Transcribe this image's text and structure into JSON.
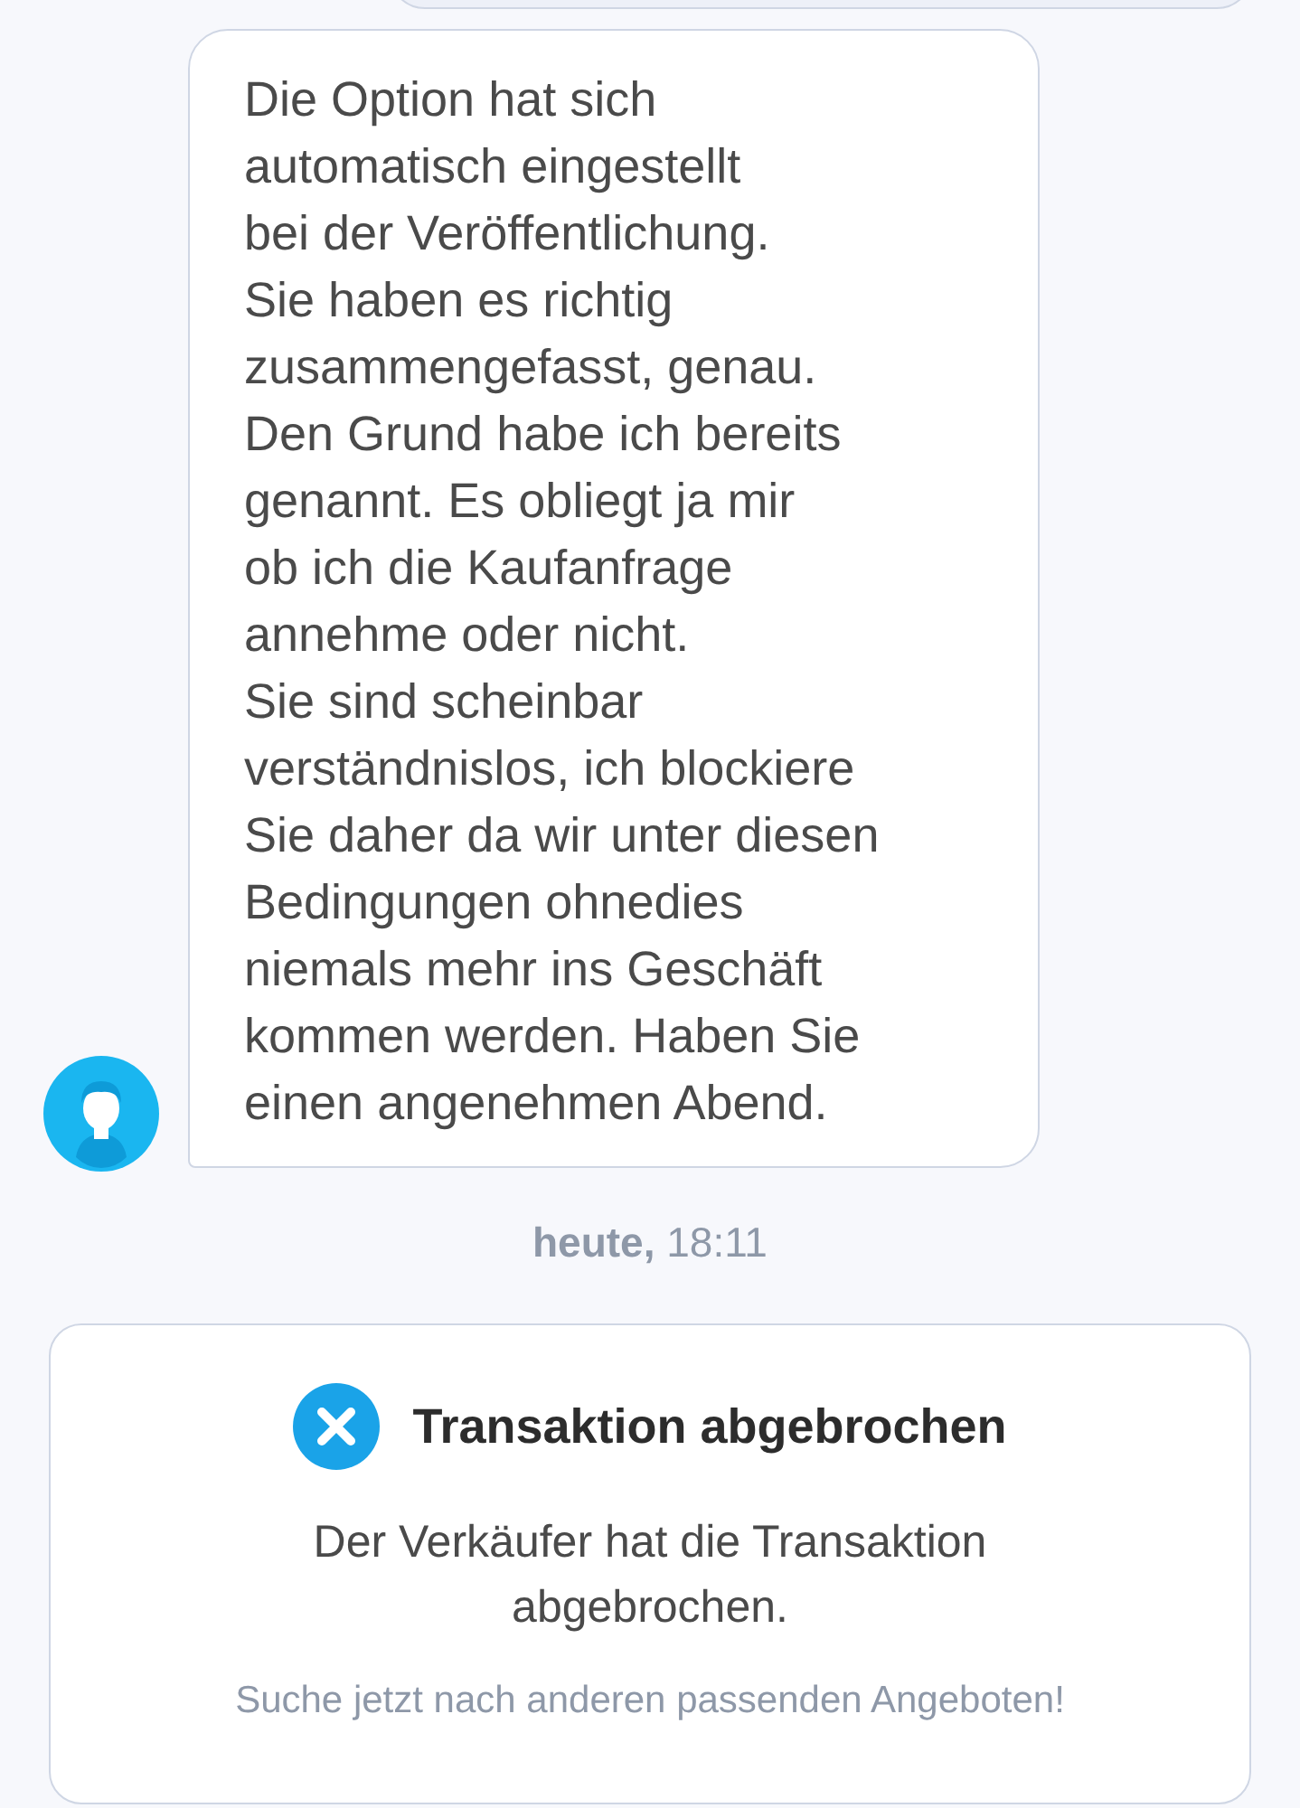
{
  "message": {
    "text": "Die Option hat sich\nautomatisch eingestellt\nbei der Veröffentlichung.\nSie haben es richtig\nzusammengefasst, genau.\nDen Grund habe ich bereits\ngenannt. Es obliegt ja mir\nob ich die Kaufanfrage\nannehme oder nicht.\nSie sind scheinbar\nverständnislos, ich blockiere\nSie daher da wir unter diesen\nBedingungen ohnedies\nniemals mehr ins Geschäft\nkommen werden. Haben Sie\neinen angenehmen Abend."
  },
  "timestamp": "**heute,** 18:11",
  "status_card": {
    "title": "Transaktion abgebrochen",
    "body": "Der Verkäufer hat die Transaktion\nabgebrochen.",
    "hint": "Suche jetzt nach anderen passenden Angeboten!"
  }
}
